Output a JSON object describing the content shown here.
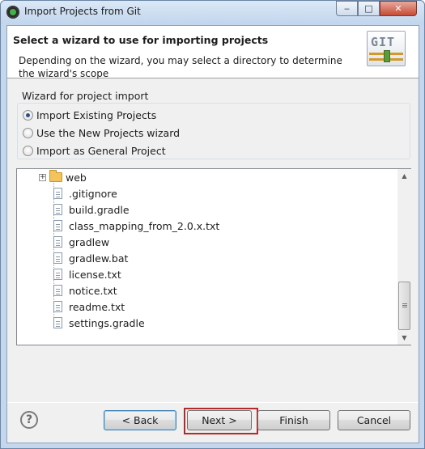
{
  "window": {
    "title": "Import Projects from Git",
    "controls": {
      "minimize": "‒",
      "maximize": "□",
      "close": "✕"
    }
  },
  "banner": {
    "title": "Select a wizard to use for importing projects",
    "description": "Depending on the wizard, you may select a directory to determine the wizard's scope",
    "logo_text": "GIT"
  },
  "wizard_group": {
    "label": "Wizard for project import",
    "options": [
      {
        "label": "Import Existing Projects",
        "selected": true
      },
      {
        "label": "Use the New Projects wizard",
        "selected": false
      },
      {
        "label": "Import as General Project",
        "selected": false
      }
    ]
  },
  "tree": {
    "folder": {
      "label": "web",
      "expander": "+"
    },
    "files": [
      ".gitignore",
      "build.gradle",
      "class_mapping_from_2.0.x.txt",
      "gradlew",
      "gradlew.bat",
      "license.txt",
      "notice.txt",
      "readme.txt",
      "settings.gradle"
    ],
    "scroll_up": "▲",
    "scroll_down": "▼"
  },
  "buttons": {
    "help": "?",
    "back": "< Back",
    "next": "Next >",
    "finish": "Finish",
    "cancel": "Cancel"
  }
}
